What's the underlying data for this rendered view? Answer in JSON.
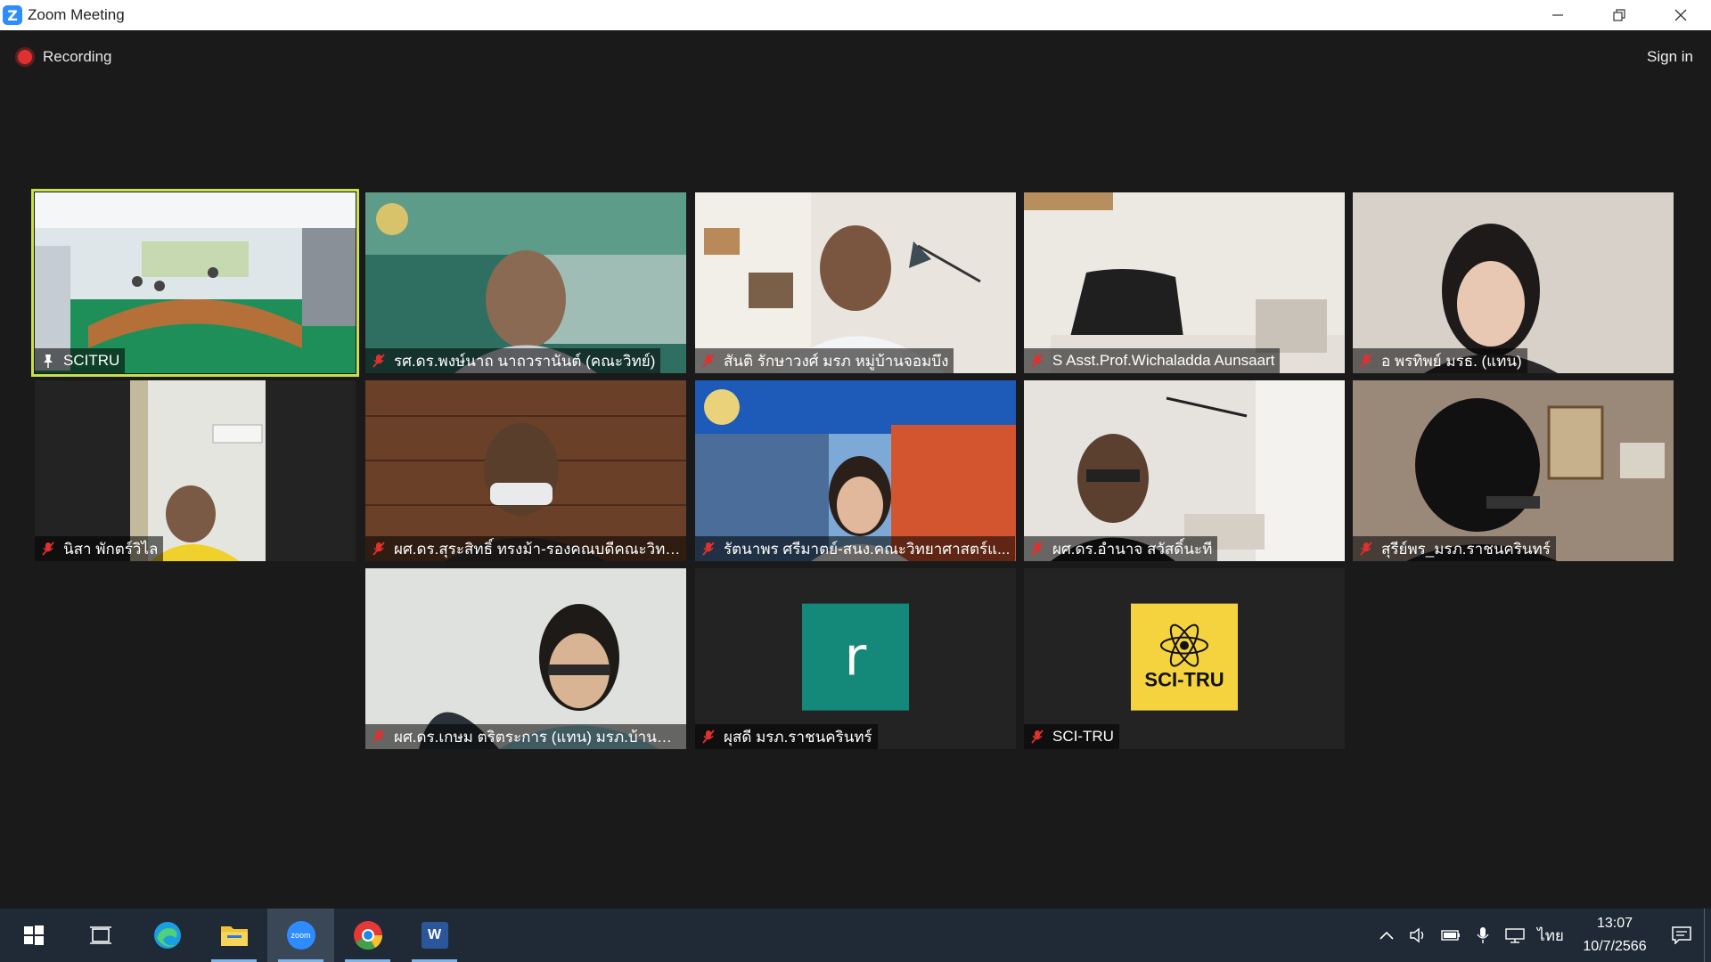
{
  "window": {
    "title": "Zoom Meeting"
  },
  "meeting": {
    "recording_label": "Recording",
    "sign_in_label": "Sign in",
    "participants": [
      {
        "name": "SCITRU",
        "muted": false,
        "pinned": true,
        "active": true
      },
      {
        "name": "รศ.ดร.พงษ์นาถ นาถวรานันต์ (คณะวิทย์)",
        "muted": true
      },
      {
        "name": "สันติ รักษาวงศ์ มรภ หมู่บ้านจอมบึง",
        "muted": true
      },
      {
        "name": "S Asst.Prof.Wichaladda Aunsaart",
        "muted": true
      },
      {
        "name": "อ พรทิพย์ มรธ. (แทน)",
        "muted": true
      },
      {
        "name": "นิสา พักตร์วิไล",
        "muted": true
      },
      {
        "name": "ผศ.ดร.สุระสิทธิ์ ทรงม้า-รองคณบดีคณะวิทย์...",
        "muted": true
      },
      {
        "name": "รัตนาพร ศรีมาตย์-สนง.คณะวิทยาศาสตร์แ...",
        "muted": true
      },
      {
        "name": "ผศ.ดร.อำนาจ สวัสดิ์นะที",
        "muted": true
      },
      {
        "name": "สุรีย์พร_มรภ.ราชนครินทร์",
        "muted": true
      },
      {
        "name": "ผศ.ดร.เกษม ตริตระการ (แทน) มรภ.บ้านสม...",
        "muted": true
      },
      {
        "name": "ผุสดี มรภ.ราชนครินทร์",
        "muted": true,
        "avatar_letter": "r"
      },
      {
        "name": "SCI-TRU",
        "muted": true,
        "avatar_text": "SCI-TRU"
      }
    ]
  },
  "taskbar": {
    "apps": [
      "windows-start",
      "task-view",
      "edge",
      "file-explorer",
      "zoom",
      "chrome",
      "word"
    ],
    "zoom_label": "zoom",
    "word_label": "W",
    "language": "ไทย",
    "time": "13:07",
    "date": "10/7/2566"
  },
  "colors": {
    "accent_active": "#c9e04b",
    "muted_icon": "#e0302f",
    "recording": "#e0302f"
  }
}
